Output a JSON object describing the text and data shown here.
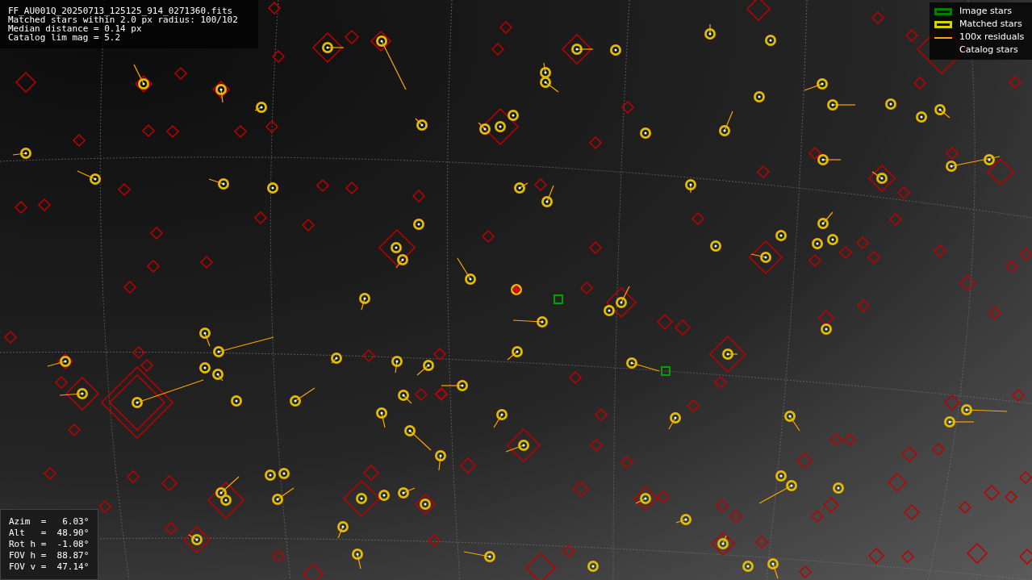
{
  "info_lines": [
    "FF_AU001Q_20250713_125125_914_0271360.fits",
    "Matched stars within 2.0 px radius: 100/102",
    "Median distance = 0.14 px",
    "Catalog lim mag = 5.2"
  ],
  "legend": [
    {
      "kind": "box",
      "label": "Image stars",
      "color": "#008000"
    },
    {
      "kind": "box",
      "label": "Matched stars",
      "color": "#d4d400"
    },
    {
      "kind": "line",
      "label": "100x residuals",
      "color": "#ffa500"
    },
    {
      "kind": "none",
      "label": "Catalog stars"
    }
  ],
  "pointing": [
    "Azim  =   6.03°",
    "Alt   =  48.90°",
    "Rot h =  -1.08°",
    "FOV h =  88.87°",
    "FOV v =  47.14°"
  ]
}
